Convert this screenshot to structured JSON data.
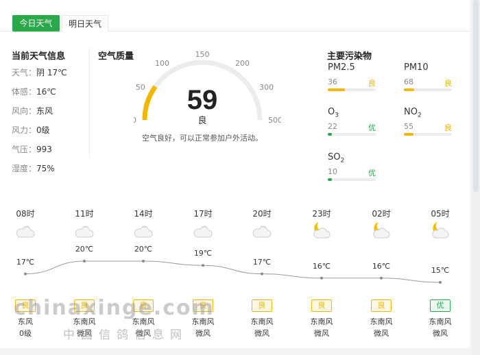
{
  "tabs": [
    {
      "label": "今日天气",
      "active": true
    },
    {
      "label": "明日天气",
      "active": false
    }
  ],
  "current": {
    "title": "当前天气信息",
    "rows": [
      {
        "key": "天气",
        "value": "阴 17℃"
      },
      {
        "key": "体感",
        "value": "16℃"
      },
      {
        "key": "风向",
        "value": "东风"
      },
      {
        "key": "风力",
        "value": "0级"
      },
      {
        "key": "气压",
        "value": "993"
      },
      {
        "key": "湿度",
        "value": "75%"
      }
    ],
    "separator": "："
  },
  "air_quality": {
    "title": "空气质量",
    "aqi": "59",
    "level": "良",
    "desc": "空气良好，可以正常参加户外活动。",
    "scale": [
      "0",
      "50",
      "100",
      "150",
      "200",
      "300",
      "500"
    ],
    "aqi_number": 59,
    "colors": {
      "track": "#ececec",
      "good": "#f2b705",
      "excellent": "#2aa84a"
    }
  },
  "pollutants": {
    "title": "主要污染物",
    "items": [
      {
        "name": "PM2.5",
        "sub": "",
        "value": "36",
        "level": "良",
        "percent": 36,
        "color": "#f2b705"
      },
      {
        "name": "PM10",
        "sub": "",
        "value": "68",
        "level": "良",
        "percent": 22,
        "color": "#f2b705"
      },
      {
        "name": "O",
        "sub": "3",
        "value": "22",
        "level": "优",
        "percent": 8,
        "color": "#2aa84a"
      },
      {
        "name": "NO",
        "sub": "2",
        "value": "55",
        "level": "良",
        "percent": 20,
        "color": "#f2b705"
      },
      {
        "name": "SO",
        "sub": "2",
        "value": "10",
        "level": "优",
        "percent": 8,
        "color": "#2aa84a"
      }
    ]
  },
  "hourly": [
    {
      "hour": "08时",
      "icon": "cloudy-icon",
      "temp": "17℃",
      "temp_value": 17,
      "aq": "良",
      "aq_color": "#f2b705",
      "wind_dir": "东风",
      "wind_force": "0级"
    },
    {
      "hour": "11时",
      "icon": "cloudy-icon",
      "temp": "20℃",
      "temp_value": 20,
      "aq": "良",
      "aq_color": "#f2b705",
      "wind_dir": "东南风",
      "wind_force": "微风"
    },
    {
      "hour": "14时",
      "icon": "cloudy-icon",
      "temp": "20℃",
      "temp_value": 20,
      "aq": "良",
      "aq_color": "#f2b705",
      "wind_dir": "东南风",
      "wind_force": "微风"
    },
    {
      "hour": "17时",
      "icon": "cloudy-icon",
      "temp": "19℃",
      "temp_value": 19,
      "aq": "良",
      "aq_color": "#f2b705",
      "wind_dir": "东南风",
      "wind_force": "微风"
    },
    {
      "hour": "20时",
      "icon": "cloudy-icon",
      "temp": "17℃",
      "temp_value": 17,
      "aq": "良",
      "aq_color": "#f2b705",
      "wind_dir": "东南风",
      "wind_force": "微风"
    },
    {
      "hour": "23时",
      "icon": "cloudy-night-icon",
      "temp": "16℃",
      "temp_value": 16,
      "aq": "良",
      "aq_color": "#f2b705",
      "wind_dir": "东南风",
      "wind_force": "微风"
    },
    {
      "hour": "02时",
      "icon": "cloudy-night-icon",
      "temp": "16℃",
      "temp_value": 16,
      "aq": "良",
      "aq_color": "#f2b705",
      "wind_dir": "东南风",
      "wind_force": "微风"
    },
    {
      "hour": "05时",
      "icon": "cloudy-night-icon",
      "temp": "15℃",
      "temp_value": 15,
      "aq": "优",
      "aq_color": "#2aa84a",
      "wind_dir": "东南风",
      "wind_force": "微风"
    }
  ],
  "watermark": {
    "domain": "chinaxinge.com",
    "site": "中国信鸽信息网"
  }
}
